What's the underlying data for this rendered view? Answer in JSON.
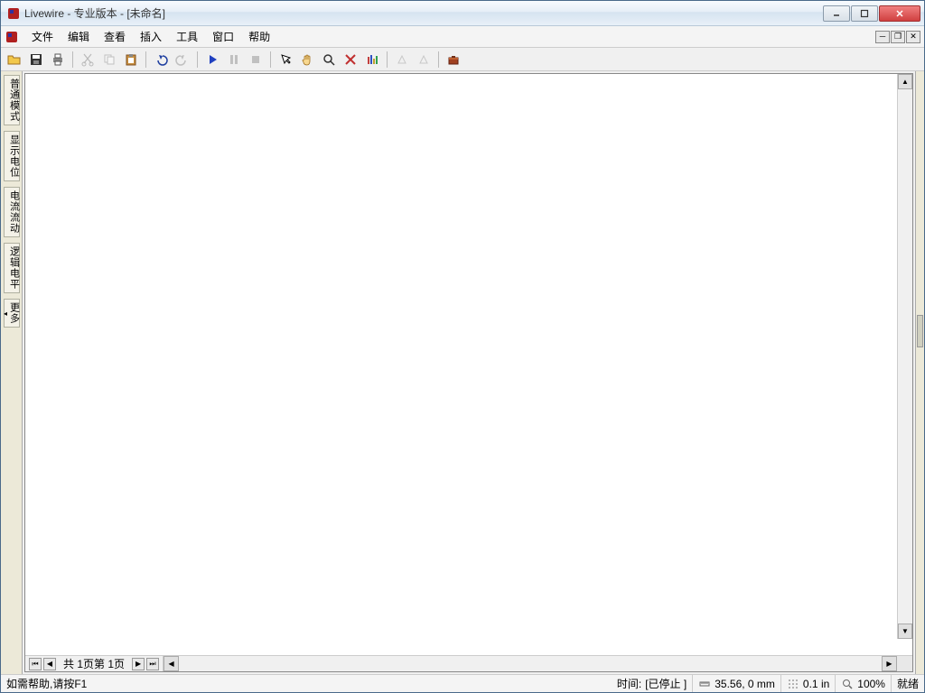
{
  "title": "Livewire - 专业版本  -  [未命名]",
  "menu": {
    "file": "文件",
    "edit": "编辑",
    "view": "查看",
    "insert": "插入",
    "tools": "工具",
    "window": "窗口",
    "help": "帮助"
  },
  "side_tabs": {
    "normal_mode": "普通模式",
    "show_potential": "显示电位",
    "current_flow": "电流流动",
    "logic_level": "逻辑电平",
    "more": "更多"
  },
  "pager": {
    "label": "共 1页第 1页"
  },
  "status": {
    "help_hint": "如需帮助,请按F1",
    "time_label": "时间:",
    "time_value": "[已停止 ]",
    "coords": "35.56, 0 mm",
    "grid": "0.1 in",
    "zoom": "100%",
    "ready": "就绪"
  }
}
